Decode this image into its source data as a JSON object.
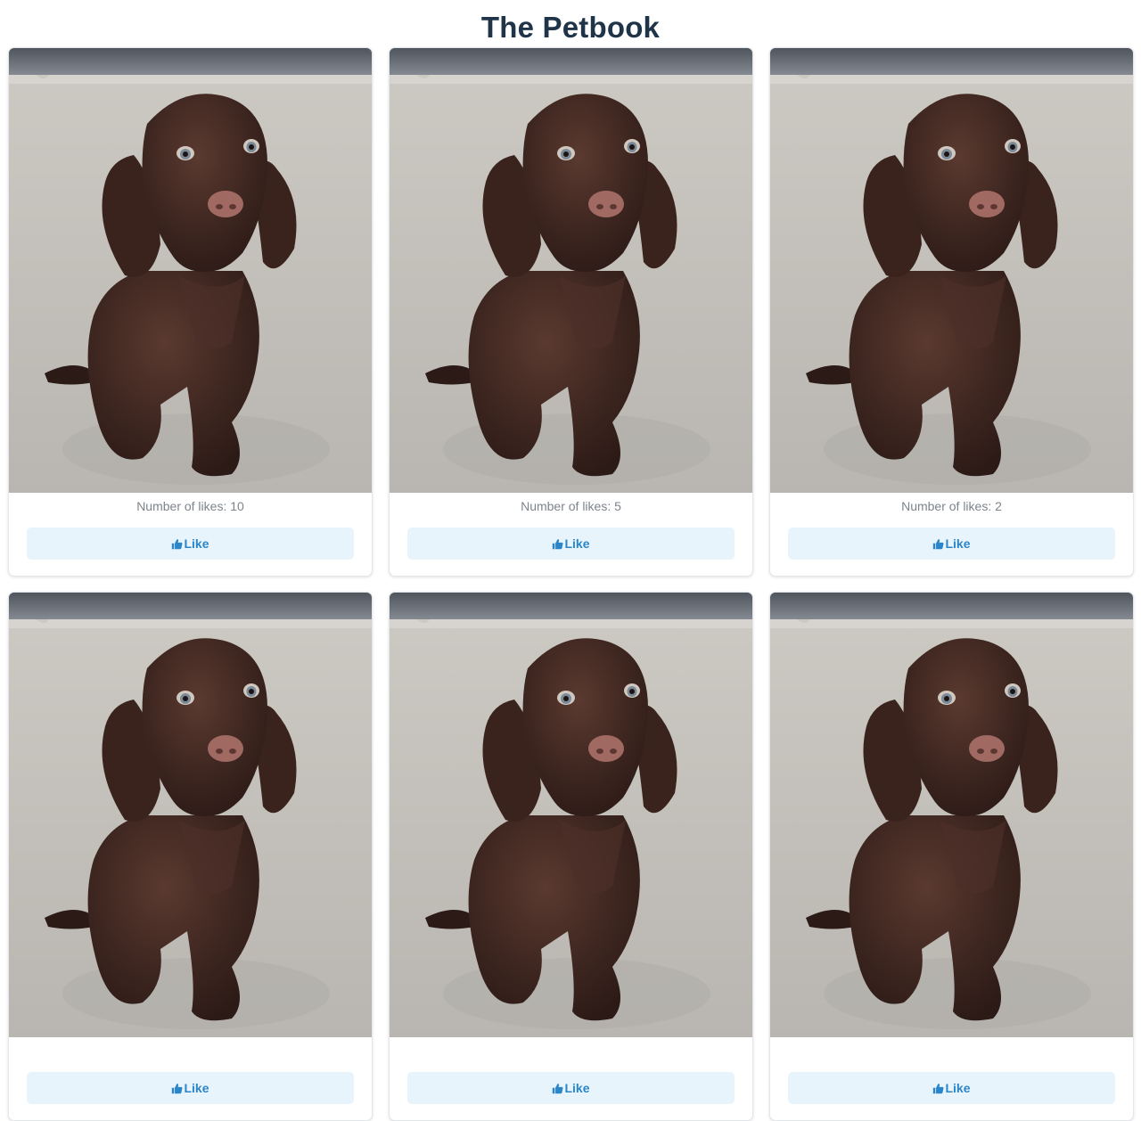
{
  "header": {
    "title": "The Petbook"
  },
  "photo": {
    "subject": "brown spaniel puppy sitting on pavement"
  },
  "cards": [
    {
      "likes_text": "Number of likes: 10",
      "like_label": "Like"
    },
    {
      "likes_text": "Number of likes: 5",
      "like_label": "Like"
    },
    {
      "likes_text": "Number of likes: 2",
      "like_label": "Like"
    },
    {
      "likes_text": "",
      "like_label": "Like"
    },
    {
      "likes_text": "",
      "like_label": "Like"
    },
    {
      "likes_text": "",
      "like_label": "Like"
    }
  ],
  "icons": {
    "like": "thumbs-up-icon"
  },
  "colors": {
    "title": "#1f3448",
    "accent": "#2a86c9",
    "button_bg": "#e8f4fc",
    "caption": "#7d848c"
  }
}
